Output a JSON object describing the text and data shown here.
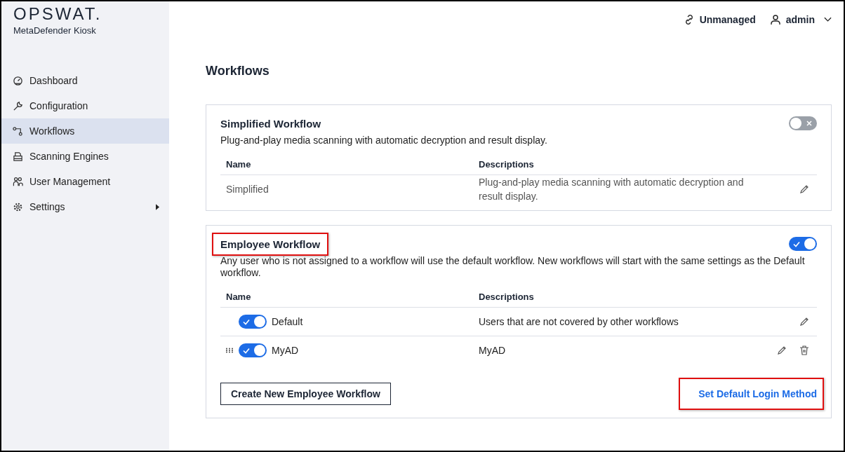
{
  "brand": {
    "logo": "OPSWAT.",
    "product": "MetaDefender Kiosk"
  },
  "sidebar": {
    "items": [
      {
        "label": "Dashboard",
        "selected": false,
        "submenu": false
      },
      {
        "label": "Configuration",
        "selected": false,
        "submenu": false
      },
      {
        "label": "Workflows",
        "selected": true,
        "submenu": false
      },
      {
        "label": "Scanning Engines",
        "selected": false,
        "submenu": false
      },
      {
        "label": "User Management",
        "selected": false,
        "submenu": false
      },
      {
        "label": "Settings",
        "selected": false,
        "submenu": true
      }
    ]
  },
  "header": {
    "status": "Unmanaged",
    "user": "admin"
  },
  "page_title": "Workflows",
  "workflows": [
    {
      "title": "Simplified Workflow",
      "highlighted": false,
      "on": false,
      "description": "Plug-and-play media scanning with automatic decryption and result display.",
      "columns": [
        "Name",
        "Descriptions"
      ],
      "rows": [
        {
          "kind": "plain",
          "name": "Simplified",
          "description": "Plug-and-play media scanning with automatic decryption and result display.",
          "draggable": false,
          "deletable": false
        }
      ]
    },
    {
      "title": "Employee Workflow",
      "highlighted": true,
      "on": true,
      "description": "Any user who is not assigned to a workflow will use the default workflow. New workflows will start with the same settings as the Default workflow.",
      "columns": [
        "Name",
        "Descriptions"
      ],
      "rows": [
        {
          "kind": "toggle",
          "on": true,
          "name": "Default",
          "description": "Users that are not covered by other workflows",
          "draggable": false,
          "deletable": false
        },
        {
          "kind": "toggle",
          "on": true,
          "name": "MyAD",
          "description": "MyAD",
          "draggable": true,
          "deletable": true
        }
      ],
      "create_button": "Create New Employee Workflow",
      "link": {
        "label": "Set Default Login Method",
        "highlighted": true
      }
    }
  ]
}
